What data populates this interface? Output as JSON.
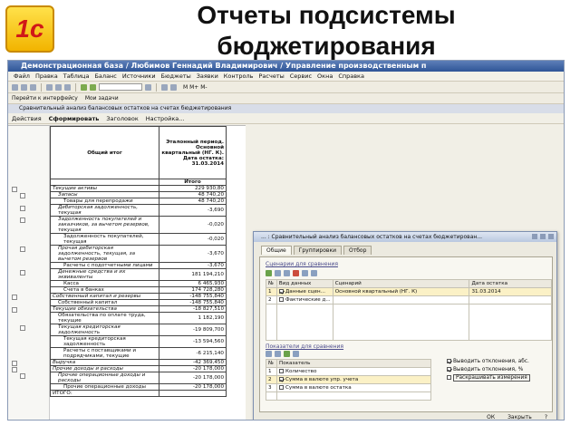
{
  "slide": {
    "title": "Отчеты подсистемы бюджетирования",
    "logo_text": "1с"
  },
  "window": {
    "title": "Демонстрационная база / Любимов Геннадий Владимирович / Управление производственным п",
    "menu": [
      "Файл",
      "Правка",
      "Таблица",
      "Баланс",
      "Источники",
      "Бюджеты",
      "Заявки",
      "Контроль",
      "Расчеты",
      "Сервис",
      "Окна",
      "Справка"
    ],
    "toolbar_right": "M  M+  M-",
    "toolbar2": [
      "Перейти к интерфейсу",
      "Мои задачи"
    ],
    "subtitle": "Сравнительный анализ балансовых остатков на счетах бюджетирования",
    "actions": {
      "actions": "Действия",
      "generate": "Сформировать",
      "header": "Заголовок",
      "settings": "Настройка..."
    }
  },
  "report": {
    "header": {
      "col1": "Общий итог",
      "col2": "Эталонный период. Основной квартальный (НГ. К). Дата остатка: 31.03.2014",
      "total_label": "Итого"
    },
    "rows": [
      {
        "name": "Текущие активы",
        "value": "229 930,80",
        "indent": 0,
        "italic": true
      },
      {
        "name": "Запасы",
        "value": "48 740,20",
        "indent": 1,
        "italic": true
      },
      {
        "name": "Товары для перепродажи",
        "value": "48 740,20",
        "indent": 2,
        "italic": false
      },
      {
        "name": "Дебиторская задолженность, текущая",
        "value": "-3,690",
        "indent": 1,
        "italic": true
      },
      {
        "name": "Задолженность покупателей и заказчиков, за вычетом резервов, текущая",
        "value": "-0,020",
        "indent": 1,
        "italic": true
      },
      {
        "name": "Задолженность покупателей, текущая",
        "value": "-0,020",
        "indent": 2,
        "italic": false
      },
      {
        "name": "Прочая дебиторская задолженность, текущая, за вычетом резервов",
        "value": "-3,670",
        "indent": 1,
        "italic": true
      },
      {
        "name": "Расчеты с подотчетными лицами",
        "value": "-3,670",
        "indent": 2,
        "italic": false
      },
      {
        "name": "Денежные средства и их эквиваленты",
        "value": "181 194,210",
        "indent": 1,
        "italic": true
      },
      {
        "name": "Касса",
        "value": "6 465,930",
        "indent": 2,
        "italic": false
      },
      {
        "name": "Счета в банках",
        "value": "174 728,280",
        "indent": 2,
        "italic": false
      },
      {
        "name": "Собственный капитал и резервы",
        "value": "-148 755,840",
        "indent": 0,
        "italic": true
      },
      {
        "name": "Собственный капитал",
        "value": "-148 755,840",
        "indent": 1,
        "italic": false
      },
      {
        "name": "Текущие обязательства",
        "value": "-18 827,510",
        "indent": 0,
        "italic": true
      },
      {
        "name": "Обязательства по оплате труда, текущие",
        "value": "1 182,190",
        "indent": 1,
        "italic": false
      },
      {
        "name": "Текущая кредиторская задолженность",
        "value": "-19 809,700",
        "indent": 1,
        "italic": true
      },
      {
        "name": "Текущая кредиторская задолженность",
        "value": "-13 594,560",
        "indent": 2,
        "italic": false
      },
      {
        "name": "Расчеты с поставщиками и подрядчиками, текущие",
        "value": "-6 215,140",
        "indent": 2,
        "italic": false
      },
      {
        "name": "Выручка",
        "value": "-42 369,450",
        "indent": 0,
        "italic": true
      },
      {
        "name": "Прочие доходы и расходы",
        "value": "-20 178,000",
        "indent": 0,
        "italic": true
      },
      {
        "name": "Прочие операционные доходы и расходы",
        "value": "-20 178,000",
        "indent": 1,
        "italic": true
      },
      {
        "name": "Прочие операционные доходы",
        "value": "-20 178,000",
        "indent": 2,
        "italic": false
      },
      {
        "name": "ИТОГО:",
        "value": "",
        "indent": 0,
        "italic": false
      }
    ]
  },
  "dialog": {
    "title": "... : Сравнительный анализ балансовых остатков на счетах бюджетирован...",
    "tabs": [
      "Общие",
      "Группировки",
      "Отбор"
    ],
    "scenarios_label": "Сценарии для сравнения",
    "scen_headers": [
      "№",
      "Вид данных",
      "Сценарий",
      "Дата остатка"
    ],
    "scen_rows": [
      {
        "n": "1",
        "kind": "Данные сцен...",
        "scenario": "Основной квартальный (НГ. К)",
        "date": "31.03.2014",
        "checked": true
      },
      {
        "n": "2",
        "kind": "Фактические д...",
        "scenario": "",
        "date": "",
        "checked": false
      }
    ],
    "indicators_label": "Показатели для сравнения",
    "ind_headers": [
      "№",
      "Показатель"
    ],
    "ind_rows": [
      {
        "n": "1",
        "name": "Количество",
        "checked": false
      },
      {
        "n": "2",
        "name": "Сумма в валюте упр. учета",
        "checked": true
      },
      {
        "n": "3",
        "name": "Сумма в валюте остатка",
        "checked": false
      }
    ],
    "options": [
      "Выводить отклонения, абс.",
      "Выводить отклонения, %",
      "Раскрашивать измерения"
    ],
    "ok": "ОК",
    "close": "Закрыть"
  }
}
